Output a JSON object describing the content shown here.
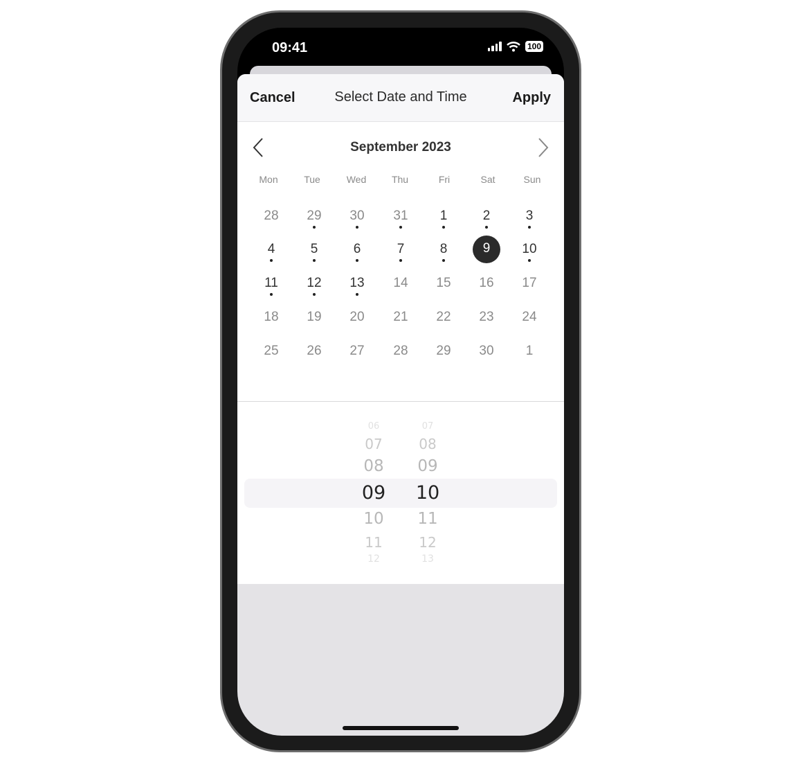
{
  "status_bar": {
    "time": "09:41",
    "battery": "100",
    "icons": [
      "signal-icon",
      "wifi-icon",
      "battery-icon"
    ]
  },
  "header": {
    "cancel_label": "Cancel",
    "title": "Select Date and Time",
    "apply_label": "Apply"
  },
  "calendar": {
    "month_label": "September 2023",
    "weekdays": [
      "Mon",
      "Tue",
      "Wed",
      "Thu",
      "Fri",
      "Sat",
      "Sun"
    ],
    "selected_day": "9",
    "weeks": [
      [
        {
          "d": "28",
          "muted": true,
          "dot": false
        },
        {
          "d": "29",
          "muted": true,
          "dot": true
        },
        {
          "d": "30",
          "muted": true,
          "dot": true
        },
        {
          "d": "31",
          "muted": true,
          "dot": true
        },
        {
          "d": "1",
          "dot": true
        },
        {
          "d": "2",
          "dot": true
        },
        {
          "d": "3",
          "dot": true
        }
      ],
      [
        {
          "d": "4",
          "dot": true
        },
        {
          "d": "5",
          "dot": true
        },
        {
          "d": "6",
          "dot": true
        },
        {
          "d": "7",
          "dot": true
        },
        {
          "d": "8",
          "dot": true
        },
        {
          "d": "9",
          "selected": true
        },
        {
          "d": "10",
          "dot": true
        }
      ],
      [
        {
          "d": "11",
          "dot": true
        },
        {
          "d": "12",
          "dot": true
        },
        {
          "d": "13",
          "dot": true
        },
        {
          "d": "14",
          "muted": true
        },
        {
          "d": "15",
          "muted": true
        },
        {
          "d": "16",
          "muted": true
        },
        {
          "d": "17",
          "muted": true
        }
      ],
      [
        {
          "d": "18",
          "muted": true
        },
        {
          "d": "19",
          "muted": true
        },
        {
          "d": "20",
          "muted": true
        },
        {
          "d": "21",
          "muted": true
        },
        {
          "d": "22",
          "muted": true
        },
        {
          "d": "23",
          "muted": true
        },
        {
          "d": "24",
          "muted": true
        }
      ],
      [
        {
          "d": "25",
          "muted": true
        },
        {
          "d": "26",
          "muted": true
        },
        {
          "d": "27",
          "muted": true
        },
        {
          "d": "28",
          "muted": true
        },
        {
          "d": "29",
          "muted": true
        },
        {
          "d": "30",
          "muted": true
        },
        {
          "d": "1",
          "muted": true
        }
      ]
    ]
  },
  "time_picker": {
    "hours": [
      "06",
      "07",
      "08",
      "09",
      "10",
      "11",
      "12"
    ],
    "minutes": [
      "07",
      "08",
      "09",
      "10",
      "11",
      "12",
      "13"
    ],
    "selected_hour": "09",
    "selected_minute": "10"
  },
  "colors": {
    "selected_bg": "#2b2b2b",
    "muted_text": "#8a8a8a",
    "text": "#333333"
  }
}
